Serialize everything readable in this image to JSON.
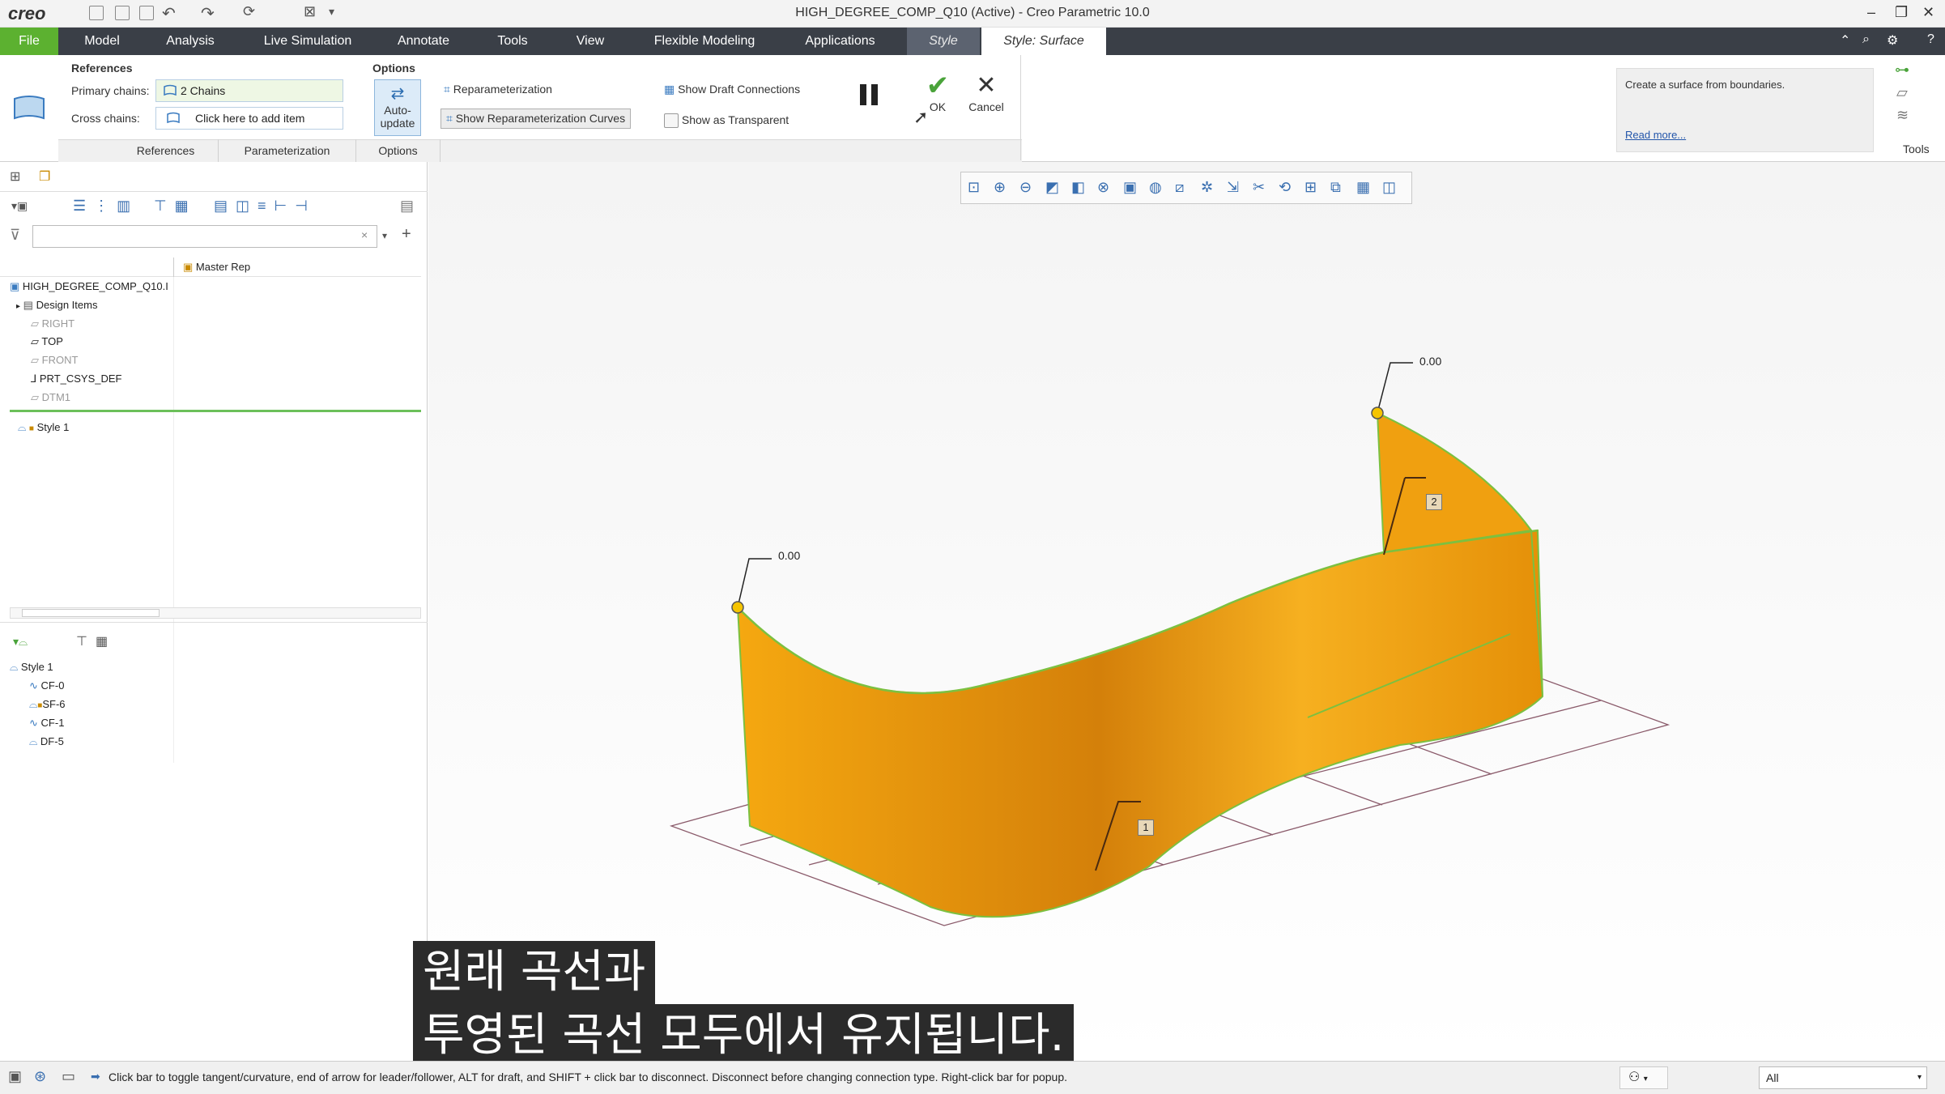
{
  "window": {
    "app_logo": "creo",
    "title": "HIGH_DEGREE_COMP_Q10 (Active) - Creo Parametric 10.0",
    "minimize_icon": "minimize-icon",
    "restore_icon": "restore-icon",
    "close_icon": "close-icon"
  },
  "menu": {
    "tabs": [
      "File",
      "Model",
      "Analysis",
      "Live Simulation",
      "Annotate",
      "Tools",
      "View",
      "Flexible Modeling",
      "Applications",
      "Style",
      "Style: Surface"
    ],
    "active_tab": "Style: Surface"
  },
  "ribbon": {
    "references": {
      "heading": "References",
      "primary_label": "Primary chains:",
      "primary_value": "2 Chains",
      "cross_label": "Cross chains:",
      "cross_value": "Click here to add item"
    },
    "options": {
      "heading": "Options",
      "autoupdate_line1": "Auto-",
      "autoupdate_line2": "update",
      "reparameterization": "Reparameterization",
      "show_reparam_curves": "Show Reparameterization Curves",
      "show_draft": "Show Draft Connections",
      "show_transparent": "Show as Transparent"
    },
    "actions": {
      "ok": "OK",
      "cancel": "Cancel"
    },
    "help": {
      "text": "Create a surface from boundaries.",
      "link": "Read more..."
    },
    "tools_label": "Tools",
    "footer_tabs": [
      "References",
      "Parameterization",
      "Options"
    ]
  },
  "model_tree": {
    "filter_placeholder": "",
    "column": "Master Rep",
    "root": "HIGH_DEGREE_COMP_Q10.I",
    "items": [
      {
        "label": "Design Items",
        "dim": false
      },
      {
        "label": "RIGHT",
        "dim": true
      },
      {
        "label": "TOP",
        "dim": false
      },
      {
        "label": "FRONT",
        "dim": true
      },
      {
        "label": "PRT_CSYS_DEF",
        "dim": false
      },
      {
        "label": "DTM1",
        "dim": true
      }
    ],
    "style_item": "Style 1"
  },
  "style_tree": {
    "root": "Style 1",
    "items": [
      "CF-0",
      "SF-6",
      "CF-1",
      "DF-5"
    ]
  },
  "viewport": {
    "dimension_left": "0.00",
    "dimension_right": "0.00",
    "tag_1": "1",
    "tag_2": "2",
    "surface_color": "#f2a20c"
  },
  "subtitles": {
    "line1": "원래 곡선과",
    "line2": "투영된 곡선 모두에서 유지됩니다."
  },
  "statusbar": {
    "message": "Click bar to toggle tangent/curvature, end of arrow for leader/follower, ALT for draft, and SHIFT + click bar to disconnect. Disconnect before changing connection type.  Right-click bar for popup.",
    "filter_value": "All"
  }
}
